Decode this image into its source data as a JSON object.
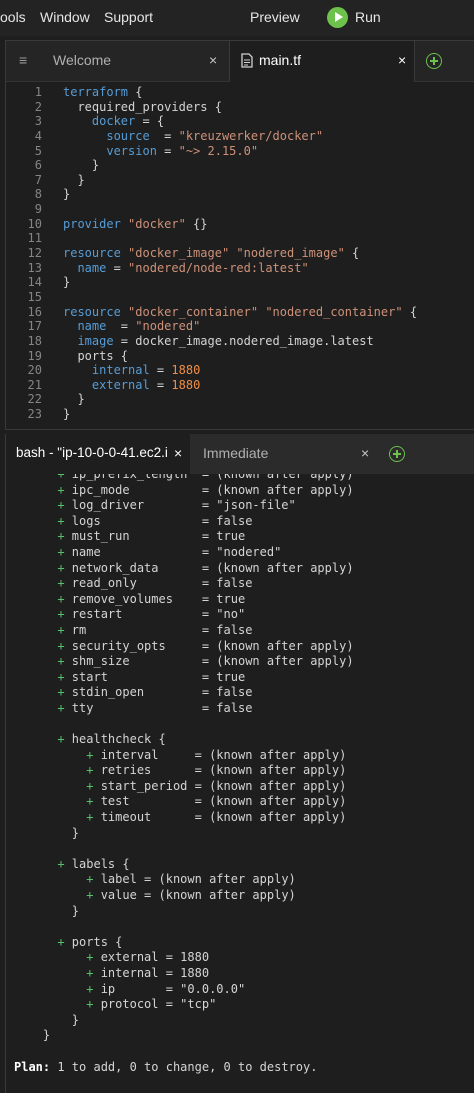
{
  "menu": {
    "tools": "ools",
    "window": "Window",
    "support": "Support",
    "preview": "Preview",
    "run": "Run"
  },
  "editor": {
    "tabs": [
      {
        "label": "Welcome"
      },
      {
        "label": "main.tf"
      }
    ],
    "close_glyph": "×",
    "lines": [
      [
        [
          "k",
          "terraform"
        ],
        [
          "w",
          " {"
        ]
      ],
      [
        [
          "w",
          "  required_providers {"
        ]
      ],
      [
        [
          "k",
          "    docker"
        ],
        [
          "w",
          " = {"
        ]
      ],
      [
        [
          "k",
          "      source"
        ],
        [
          "w",
          "  = "
        ],
        [
          "s",
          "\"kreuzwerker/docker\""
        ]
      ],
      [
        [
          "k",
          "      version"
        ],
        [
          "w",
          " = "
        ],
        [
          "s",
          "\"~> 2.15.0\""
        ]
      ],
      [
        [
          "w",
          "    }"
        ]
      ],
      [
        [
          "w",
          "  }"
        ]
      ],
      [
        [
          "w",
          "}"
        ]
      ],
      [],
      [
        [
          "k",
          "provider"
        ],
        [
          "w",
          " "
        ],
        [
          "s",
          "\"docker\""
        ],
        [
          "w",
          " {}"
        ]
      ],
      [],
      [
        [
          "k",
          "resource"
        ],
        [
          "w",
          " "
        ],
        [
          "s",
          "\"docker_image\""
        ],
        [
          "w",
          " "
        ],
        [
          "s",
          "\"nodered_image\""
        ],
        [
          "w",
          " {"
        ]
      ],
      [
        [
          "k",
          "  name"
        ],
        [
          "w",
          " = "
        ],
        [
          "s",
          "\"nodered/node-red:latest\""
        ]
      ],
      [
        [
          "w",
          "}"
        ]
      ],
      [],
      [
        [
          "k",
          "resource"
        ],
        [
          "w",
          " "
        ],
        [
          "s",
          "\"docker_container\""
        ],
        [
          "w",
          " "
        ],
        [
          "s",
          "\"nodered_container\""
        ],
        [
          "w",
          " {"
        ]
      ],
      [
        [
          "k",
          "  name"
        ],
        [
          "w",
          "  = "
        ],
        [
          "s",
          "\"nodered\""
        ]
      ],
      [
        [
          "k",
          "  image"
        ],
        [
          "w",
          " = docker_image.nodered_image.latest"
        ]
      ],
      [
        [
          "w",
          "  ports {"
        ]
      ],
      [
        [
          "k",
          "    internal"
        ],
        [
          "w",
          " = "
        ],
        [
          "n",
          "1880"
        ]
      ],
      [
        [
          "k",
          "    external"
        ],
        [
          "w",
          " = "
        ],
        [
          "n",
          "1880"
        ]
      ],
      [
        [
          "w",
          "  }"
        ]
      ],
      [
        [
          "w",
          "}"
        ]
      ]
    ]
  },
  "terminal": {
    "tabs": [
      {
        "label": "bash - \"ip-10-0-0-41.ec2.i"
      },
      {
        "label": "Immediate"
      }
    ],
    "close_glyph": "×",
    "lines": [
      [
        [
          "g",
          "      + "
        ],
        [
          "w",
          "ip_prefix_length  = (known after apply)"
        ]
      ],
      [
        [
          "g",
          "      + "
        ],
        [
          "w",
          "ipc_mode          = (known after apply)"
        ]
      ],
      [
        [
          "g",
          "      + "
        ],
        [
          "w",
          "log_driver        = \"json-file\""
        ]
      ],
      [
        [
          "g",
          "      + "
        ],
        [
          "w",
          "logs              = false"
        ]
      ],
      [
        [
          "g",
          "      + "
        ],
        [
          "w",
          "must_run          = true"
        ]
      ],
      [
        [
          "g",
          "      + "
        ],
        [
          "w",
          "name              = \"nodered\""
        ]
      ],
      [
        [
          "g",
          "      + "
        ],
        [
          "w",
          "network_data      = (known after apply)"
        ]
      ],
      [
        [
          "g",
          "      + "
        ],
        [
          "w",
          "read_only         = false"
        ]
      ],
      [
        [
          "g",
          "      + "
        ],
        [
          "w",
          "remove_volumes    = true"
        ]
      ],
      [
        [
          "g",
          "      + "
        ],
        [
          "w",
          "restart           = \"no\""
        ]
      ],
      [
        [
          "g",
          "      + "
        ],
        [
          "w",
          "rm                = false"
        ]
      ],
      [
        [
          "g",
          "      + "
        ],
        [
          "w",
          "security_opts     = (known after apply)"
        ]
      ],
      [
        [
          "g",
          "      + "
        ],
        [
          "w",
          "shm_size          = (known after apply)"
        ]
      ],
      [
        [
          "g",
          "      + "
        ],
        [
          "w",
          "start             = true"
        ]
      ],
      [
        [
          "g",
          "      + "
        ],
        [
          "w",
          "stdin_open        = false"
        ]
      ],
      [
        [
          "g",
          "      + "
        ],
        [
          "w",
          "tty               = false"
        ]
      ],
      [],
      [
        [
          "g",
          "      + "
        ],
        [
          "w",
          "healthcheck {"
        ]
      ],
      [
        [
          "g",
          "          + "
        ],
        [
          "w",
          "interval     = (known after apply)"
        ]
      ],
      [
        [
          "g",
          "          + "
        ],
        [
          "w",
          "retries      = (known after apply)"
        ]
      ],
      [
        [
          "g",
          "          + "
        ],
        [
          "w",
          "start_period = (known after apply)"
        ]
      ],
      [
        [
          "g",
          "          + "
        ],
        [
          "w",
          "test         = (known after apply)"
        ]
      ],
      [
        [
          "g",
          "          + "
        ],
        [
          "w",
          "timeout      = (known after apply)"
        ]
      ],
      [
        [
          "w",
          "        }"
        ]
      ],
      [],
      [
        [
          "g",
          "      + "
        ],
        [
          "w",
          "labels {"
        ]
      ],
      [
        [
          "g",
          "          + "
        ],
        [
          "w",
          "label = (known after apply)"
        ]
      ],
      [
        [
          "g",
          "          + "
        ],
        [
          "w",
          "value = (known after apply)"
        ]
      ],
      [
        [
          "w",
          "        }"
        ]
      ],
      [],
      [
        [
          "g",
          "      + "
        ],
        [
          "w",
          "ports {"
        ]
      ],
      [
        [
          "g",
          "          + "
        ],
        [
          "w",
          "external = 1880"
        ]
      ],
      [
        [
          "g",
          "          + "
        ],
        [
          "w",
          "internal = 1880"
        ]
      ],
      [
        [
          "g",
          "          + "
        ],
        [
          "w",
          "ip       = \"0.0.0.0\""
        ]
      ],
      [
        [
          "g",
          "          + "
        ],
        [
          "w",
          "protocol = \"tcp\""
        ]
      ],
      [
        [
          "w",
          "        }"
        ]
      ],
      [
        [
          "w",
          "    }"
        ]
      ],
      [],
      [
        [
          "b",
          "Plan:"
        ],
        [
          "w",
          " 1 to add, 0 to change, 0 to destroy."
        ]
      ]
    ]
  }
}
